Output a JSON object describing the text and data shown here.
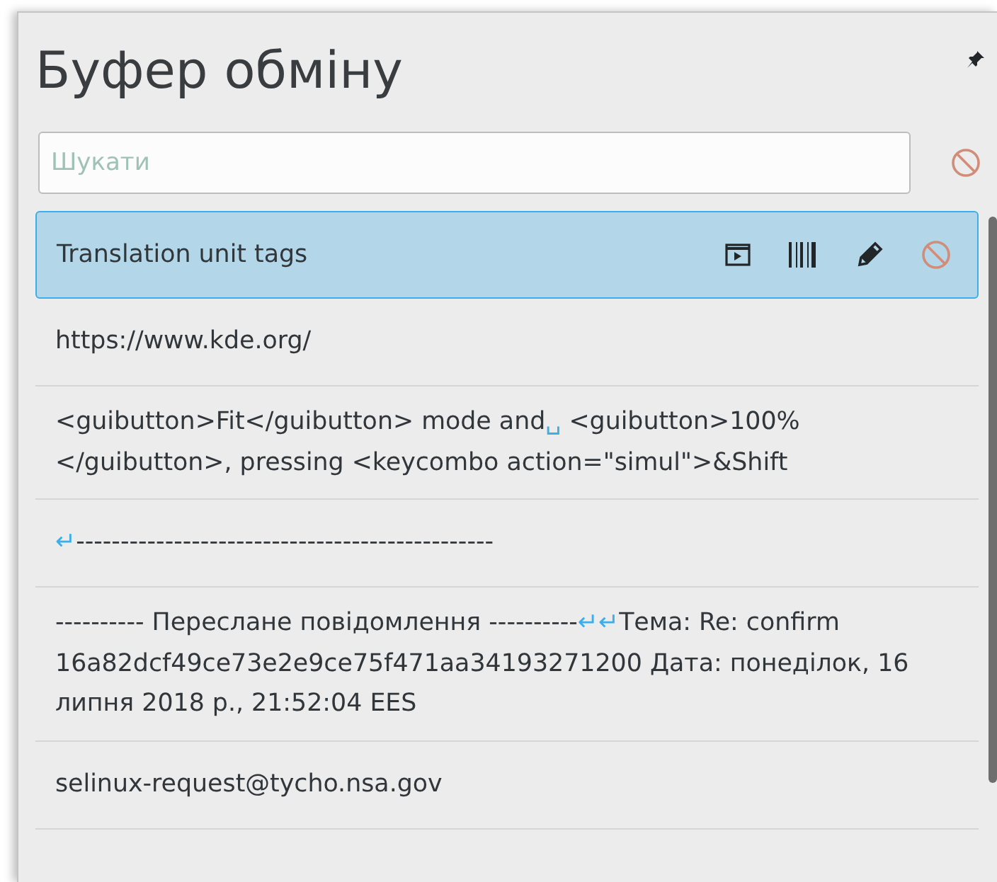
{
  "title": "Буфер обміну",
  "search": {
    "placeholder": "Шукати"
  },
  "items": [
    {
      "selected": true,
      "segments": [
        {
          "kind": "text",
          "text": "Translation unit tags"
        }
      ]
    },
    {
      "selected": false,
      "segments": [
        {
          "kind": "text",
          "text": "https://www.kde.org/"
        }
      ]
    },
    {
      "selected": false,
      "segments": [
        {
          "kind": "text",
          "text": "<guibutton>Fit</guibutton> mode and"
        },
        {
          "kind": "marker",
          "text": "␣"
        },
        {
          "kind": "text",
          "text": " <guibutton>100%</guibutton>, pressing <keycombo action=\"simul\">&Shift"
        }
      ]
    },
    {
      "selected": false,
      "segments": [
        {
          "kind": "marker",
          "text": "↵"
        },
        {
          "kind": "text",
          "text": "-----------------------------------------------"
        }
      ]
    },
    {
      "selected": false,
      "segments": [
        {
          "kind": "text",
          "text": "---------- Переслане повідомлення ----------"
        },
        {
          "kind": "marker",
          "text": "↵↵"
        },
        {
          "kind": "text",
          "text": "Тема: Re: confirm 16a82dcf49ce73e2e9ce75f471aa34193271200 Дата: понеділок, 16 липня 2018 р., 21:52:04 EES"
        }
      ]
    },
    {
      "selected": false,
      "segments": [
        {
          "kind": "text",
          "text": "selinux-request@tycho.nsa.gov"
        }
      ]
    }
  ]
}
